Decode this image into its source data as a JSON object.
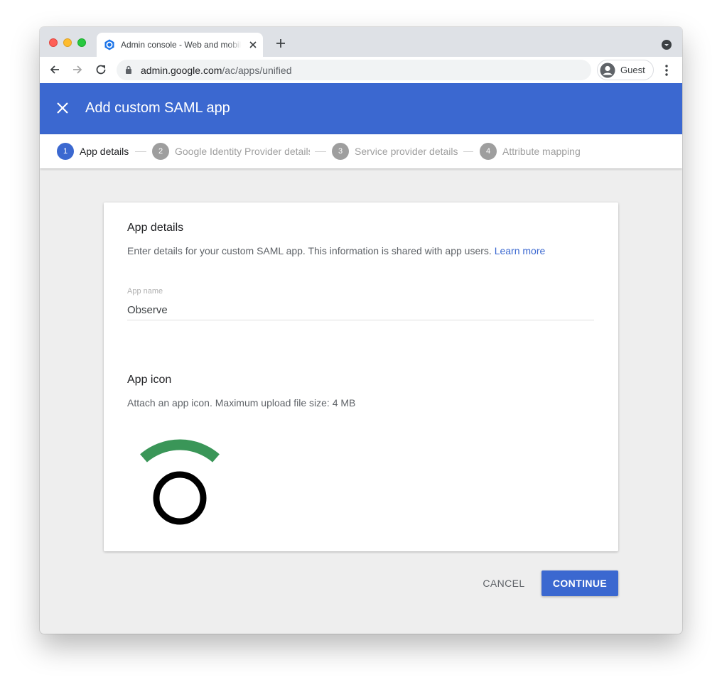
{
  "browser": {
    "tab_title": "Admin console - Web and mobile apps",
    "url_host": "admin.google.com",
    "url_path": "/ac/apps/unified",
    "profile_name": "Guest",
    "icons": [
      "back-icon",
      "forward-icon",
      "reload-icon",
      "lock-icon",
      "menu-icon"
    ]
  },
  "header": {
    "title": "Add custom SAML app"
  },
  "stepper": {
    "steps": [
      {
        "num": "1",
        "label": "App details",
        "active": true
      },
      {
        "num": "2",
        "label": "Google Identity Provider details",
        "active": false
      },
      {
        "num": "3",
        "label": "Service provider details",
        "active": false
      },
      {
        "num": "4",
        "label": "Attribute mapping",
        "active": false
      }
    ]
  },
  "app_details": {
    "title": "App details",
    "description": "Enter details for your custom SAML app. This information is shared with app users.",
    "learn_more": "Learn more",
    "app_name_label": "App name",
    "app_name_value": "Observe"
  },
  "app_icon": {
    "title": "App icon",
    "description": "Attach an app icon. Maximum upload file size: 4 MB",
    "colors": {
      "arc": "#3a9658",
      "ring": "#000000"
    }
  },
  "footer": {
    "cancel_label": "CANCEL",
    "continue_label": "CONTINUE"
  },
  "colors": {
    "accent": "#3b68d0",
    "page_bg": "#eeeeee"
  }
}
